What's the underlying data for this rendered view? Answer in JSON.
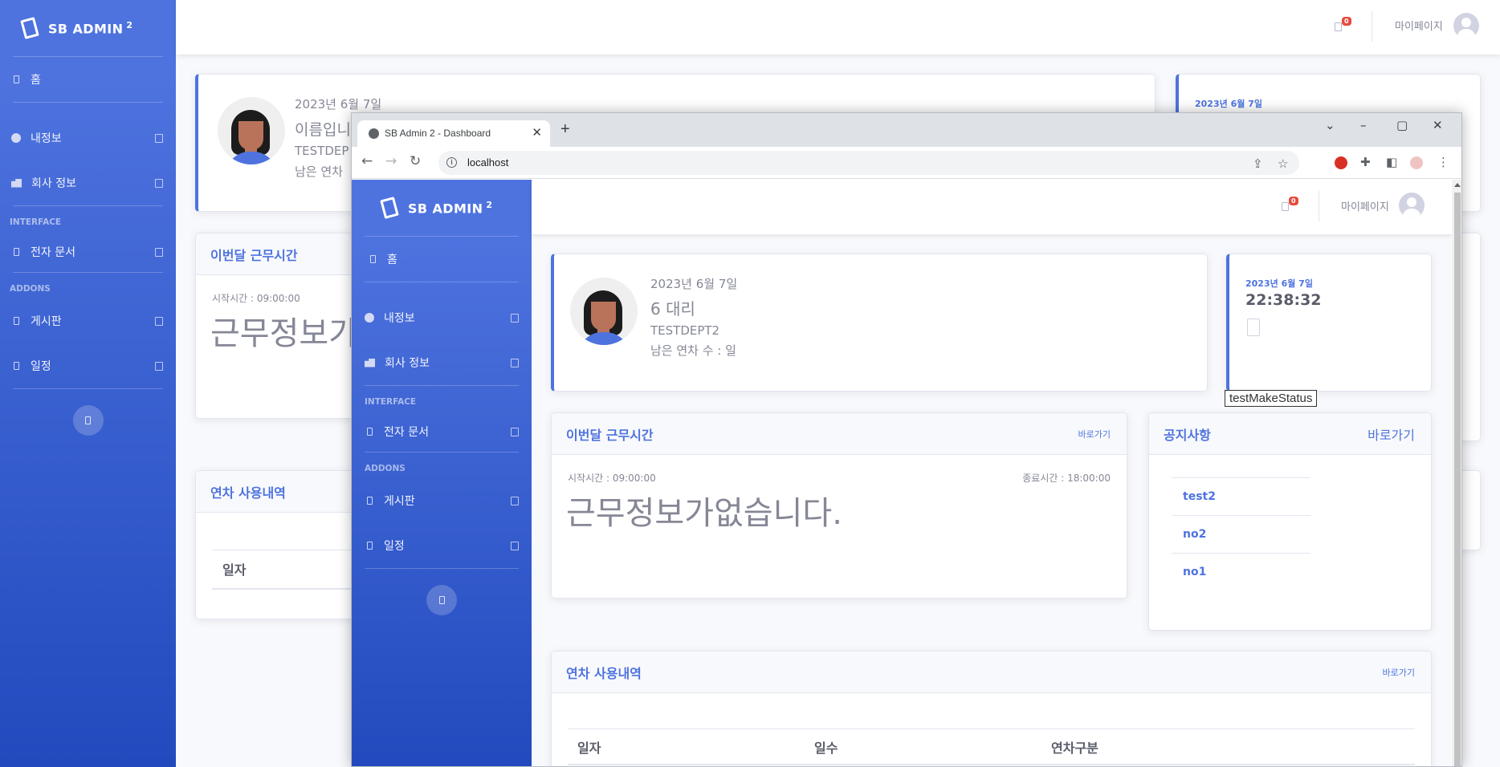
{
  "brand": {
    "name": "SB ADMIN",
    "sup": "2"
  },
  "sidebar": {
    "items": [
      {
        "label": "홈"
      },
      {
        "label": "내정보"
      },
      {
        "label": "회사 정보"
      },
      {
        "label": "전자 문서"
      },
      {
        "label": "게시판"
      },
      {
        "label": "일정"
      }
    ],
    "heading_interface": "INTERFACE",
    "heading_addons": "ADDONS"
  },
  "topbar": {
    "badge": "0",
    "user": "마이페이지"
  },
  "bg": {
    "profile": {
      "date": "2023년 6월 7일",
      "name": "이름입니",
      "dept": "TESTDEP",
      "leave": "남은 연차"
    },
    "clock_date": "2023년 6월 7일",
    "worktime": {
      "title": "이번달 근무시간",
      "start": "시작시간 : 09:00:00",
      "big": "근무정보가"
    },
    "leave_history": {
      "title": "연차 사용내역",
      "col_date": "일자"
    }
  },
  "browser": {
    "tab_title": "SB Admin 2 - Dashboard",
    "url": "localhost"
  },
  "fg": {
    "profile": {
      "date": "2023년 6월 7일",
      "name": "6 대리",
      "dept": "TESTDEPT2",
      "leave": "남은 연차 수 : 일"
    },
    "clock": {
      "date": "2023년 6월 7일",
      "time": "22:38:32"
    },
    "tooltip": "testMakeStatus",
    "worktime": {
      "title": "이번달 근무시간",
      "link": "바로가기",
      "start": "시작시간 : 09:00:00",
      "end": "종료시간 : 18:00:00",
      "empty": "근무정보가없습니다."
    },
    "notice": {
      "title": "공지사항",
      "link": "바로가기",
      "items": [
        "test2",
        "no2",
        "no1"
      ]
    },
    "leave_history": {
      "title": "연차 사용내역",
      "link": "바로가기",
      "columns": [
        "일자",
        "일수",
        "연차구분"
      ]
    }
  },
  "colors": {
    "primary": "#4e73df",
    "danger": "#e74a3b"
  }
}
